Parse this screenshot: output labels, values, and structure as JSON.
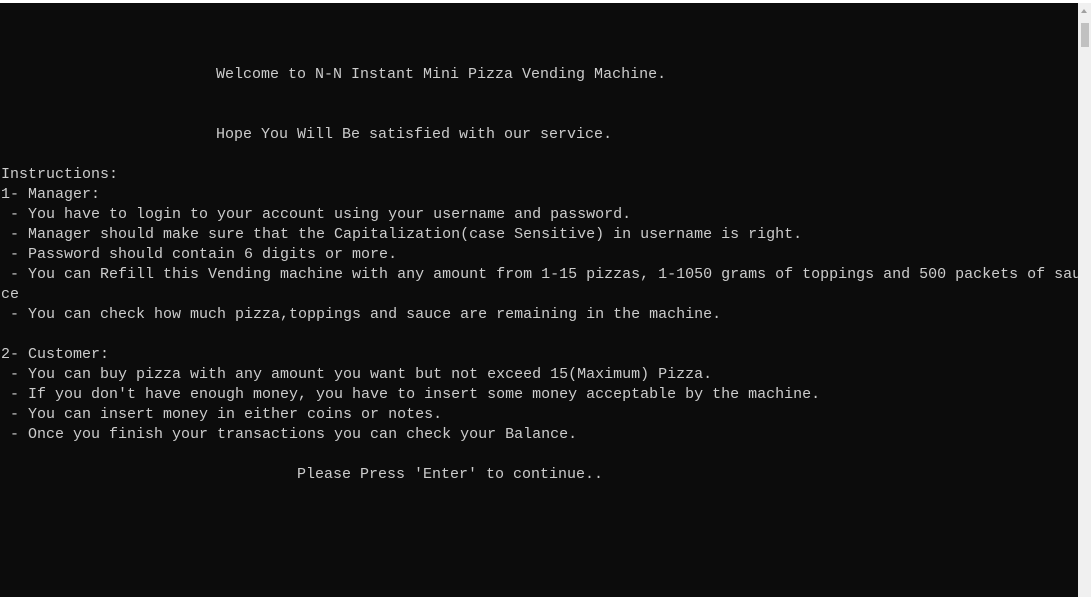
{
  "console": {
    "lines": {
      "welcome": "Welcome to N-N Instant Mini Pizza Vending Machine.",
      "hope": "Hope You Will Be satisfied with our service.",
      "instructions": "Instructions:",
      "manager_header": "1- Manager:",
      "manager_1": " - You have to login to your account using your username and password.",
      "manager_2": " - Manager should make sure that the Capitalization(case Sensitive) in username is right.",
      "manager_3": " - Password should contain 6 digits or more.",
      "manager_4": " - You can Refill this Vending machine with any amount from 1-15 pizzas, 1-1050 grams of toppings and 500 packets of sau",
      "manager_4_wrap": "ce",
      "manager_5": " - You can check how much pizza,toppings and sauce are remaining in the machine.",
      "customer_header": "2- Customer:",
      "customer_1": " - You can buy pizza with any amount you want but not exceed 15(Maximum) Pizza.",
      "customer_2": " - If you don't have enough money, you have to insert some money acceptable by the machine.",
      "customer_3": " - You can insert money in either coins or notes.",
      "customer_4": " - Once you finish your transactions you can check your Balance.",
      "press_enter": "Please Press 'Enter' to continue.."
    }
  },
  "colors": {
    "background": "#0c0c0c",
    "text": "#cccccc"
  }
}
